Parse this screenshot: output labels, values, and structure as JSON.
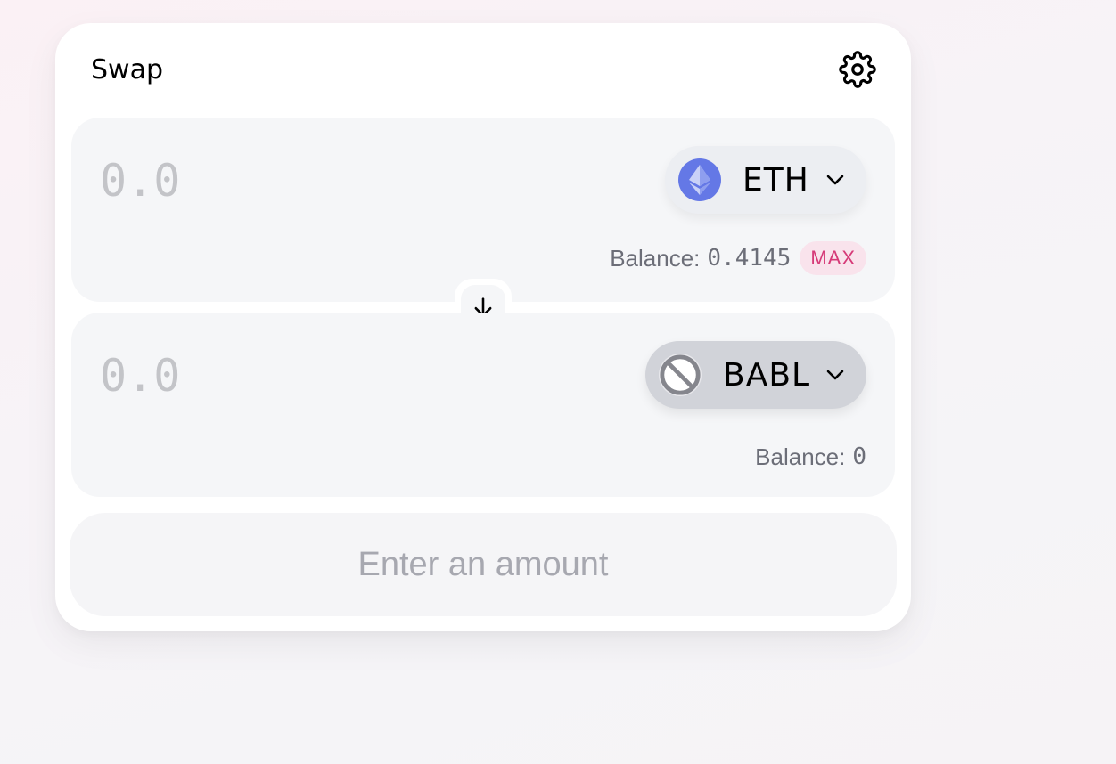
{
  "swap": {
    "title": "Swap",
    "settings_icon": "gear-icon",
    "input": {
      "placeholder": "0.0",
      "token": {
        "symbol": "ETH",
        "logo": "ethereum-logo",
        "color": "#6478e6"
      },
      "balance_label": "Balance:",
      "balance_value": "0.4145",
      "max_label": "MAX"
    },
    "swap_direction_icon": "arrow-down-icon",
    "output": {
      "placeholder": "0.0",
      "token": {
        "symbol": "BABL",
        "logo": "unknown-token-icon"
      },
      "balance_label": "Balance:",
      "balance_value": "0"
    },
    "submit_label": "Enter an amount"
  },
  "colors": {
    "accent": "#d63a78",
    "panel": "#f5f6f8",
    "muted_text": "#6c6e78"
  }
}
